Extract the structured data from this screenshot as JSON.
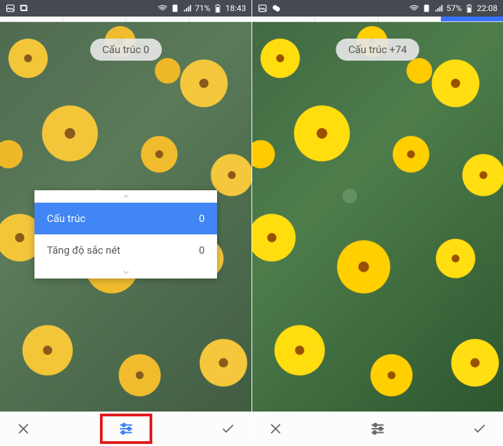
{
  "left": {
    "status_bar": {
      "battery_text": "71%",
      "time": "18:43"
    },
    "pill_label": "Cấu trúc 0",
    "panel": {
      "rows": [
        {
          "label": "Cấu trúc",
          "value": "0",
          "active": true
        },
        {
          "label": "Tăng độ sắc nét",
          "value": "0",
          "active": false
        }
      ]
    }
  },
  "right": {
    "status_bar": {
      "battery_text": "57%",
      "time": "22:08"
    },
    "pill_label": "Cấu trúc +74"
  },
  "icons": {
    "close": "close-icon",
    "sliders": "sliders-icon",
    "check": "check-icon",
    "chev_up": "chevron-up-icon",
    "chev_down": "chevron-down-icon"
  }
}
